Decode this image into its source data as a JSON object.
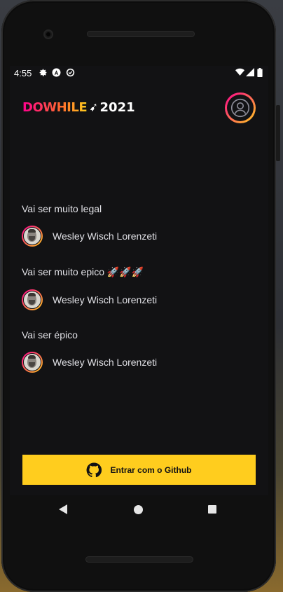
{
  "status_bar": {
    "time": "4:55",
    "left_icons": [
      "gear-icon",
      "android-a-icon",
      "data-saver-icon"
    ],
    "right_icons": [
      "wifi-icon",
      "signal-icon",
      "battery-icon"
    ]
  },
  "header": {
    "logo_word": "DOWHILE",
    "logo_year": "2021",
    "avatar_icon": "user-icon"
  },
  "messages": [
    {
      "text": "Vai ser muito legal",
      "author": "Wesley Wisch Lorenzeti"
    },
    {
      "text": "Vai ser muito epico 🚀🚀🚀",
      "author": "Wesley Wisch Lorenzeti"
    },
    {
      "text": "Vai ser épico",
      "author": "Wesley Wisch Lorenzeti"
    }
  ],
  "sign_in": {
    "label": "Entrar com o Github",
    "icon": "github-icon"
  },
  "colors": {
    "background": "#121214",
    "accent_yellow": "#ffcd1e",
    "gradient_pink": "#ff008e",
    "text": "#e1e1e6"
  },
  "nav": {
    "buttons": [
      "back-icon",
      "home-icon",
      "recent-apps-icon"
    ]
  }
}
